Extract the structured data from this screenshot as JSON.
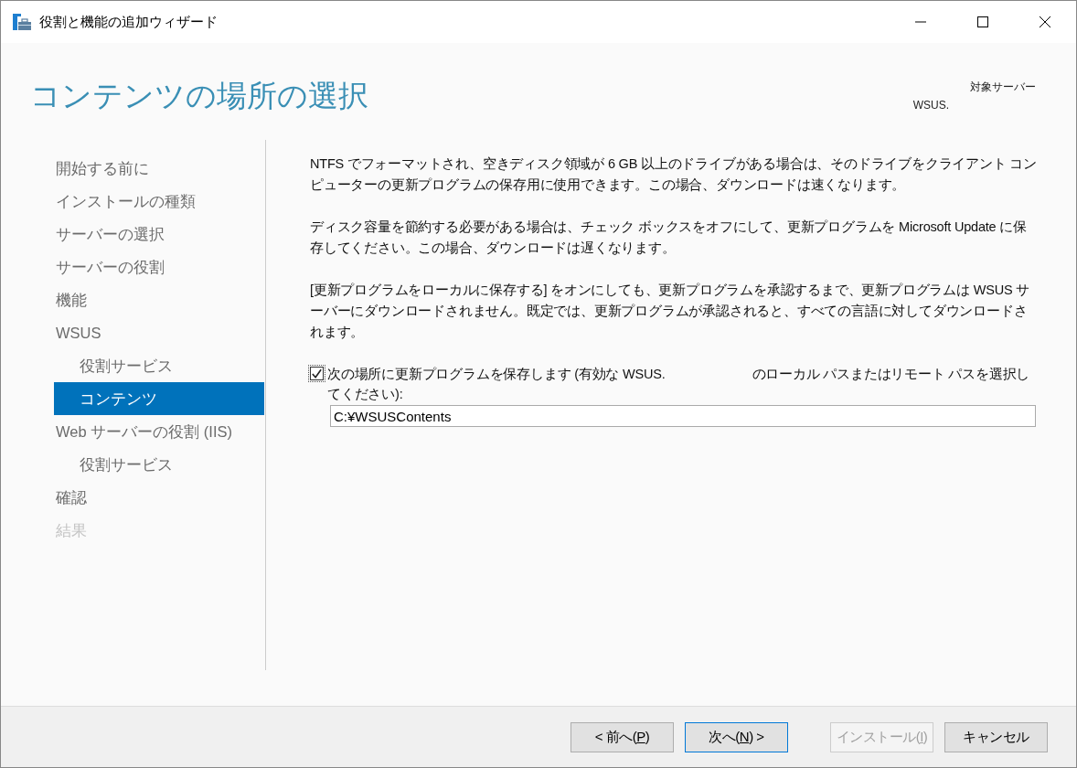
{
  "window": {
    "title": "役割と機能の追加ウィザード"
  },
  "header": {
    "title": "コンテンツの場所の選択",
    "target_label": "対象サーバー",
    "target_value": "WSUS."
  },
  "sidebar": {
    "items": [
      {
        "label": "開始する前に",
        "selected": false,
        "disabled": false
      },
      {
        "label": "インストールの種類",
        "selected": false,
        "disabled": false
      },
      {
        "label": "サーバーの選択",
        "selected": false,
        "disabled": false
      },
      {
        "label": "サーバーの役割",
        "selected": false,
        "disabled": false
      },
      {
        "label": "機能",
        "selected": false,
        "disabled": false
      },
      {
        "label": "WSUS",
        "selected": false,
        "disabled": false,
        "children": [
          {
            "label": "役割サービス",
            "selected": false,
            "disabled": false
          },
          {
            "label": "コンテンツ",
            "selected": true,
            "disabled": false
          }
        ]
      },
      {
        "label": "Web サーバーの役割 (IIS)",
        "selected": false,
        "disabled": false,
        "children": [
          {
            "label": "役割サービス",
            "selected": false,
            "disabled": false
          }
        ]
      },
      {
        "label": "確認",
        "selected": false,
        "disabled": false
      },
      {
        "label": "結果",
        "selected": false,
        "disabled": true
      }
    ]
  },
  "content": {
    "paragraphs": [
      "NTFS でフォーマットされ、空きディスク領域が 6 GB 以上のドライブがある場合は、そのドライブをクライアント コンピューターの更新プログラムの保存用に使用できます。この場合、ダウンロードは速くなります。",
      "ディスク容量を節約する必要がある場合は、チェック ボックスをオフにして、更新プログラムを Microsoft Update に保存してください。この場合、ダウンロードは遅くなります。",
      "[更新プログラムをローカルに保存する] をオンにしても、更新プログラムを承認するまで、更新プログラムは WSUS サーバーにダウンロードされません。既定では、更新プログラムが承認されると、すべての言語に対してダウンロードされます。"
    ],
    "checkbox": {
      "checked": true,
      "label_start": "次の場所に更新プログラムを保存します (有効な WSUS.",
      "label_end": "のローカル パスまたはリモート パスを選択してください):"
    },
    "path_field": {
      "value": "C:¥WSUSContents"
    }
  },
  "buttons": [
    {
      "before": "< 前へ(",
      "mnemonic": "P",
      "after": ")",
      "default": false,
      "disabled": false
    },
    {
      "before": "次へ(",
      "mnemonic": "N",
      "after": ") >",
      "default": true,
      "disabled": false
    },
    {
      "before": "インストール(",
      "mnemonic": "I",
      "after": ")",
      "default": false,
      "disabled": true
    },
    {
      "before": "キャンセル",
      "default": false,
      "disabled": false
    }
  ]
}
